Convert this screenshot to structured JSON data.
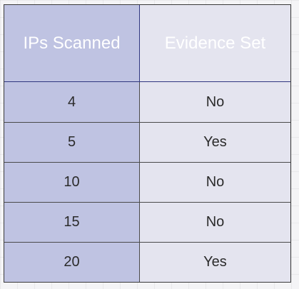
{
  "table": {
    "headers": [
      "IPs Scanned",
      "Evidence Set"
    ],
    "rows": [
      [
        "4",
        "No"
      ],
      [
        "5",
        "Yes"
      ],
      [
        "10",
        "No"
      ],
      [
        "15",
        "No"
      ],
      [
        "20",
        "Yes"
      ]
    ]
  },
  "colors": {
    "header_bg": "#4f5bb7",
    "first_col_bg": "#bfc3e2",
    "second_col_bg": "#e4e4ef",
    "border": "#3a3a3a"
  }
}
